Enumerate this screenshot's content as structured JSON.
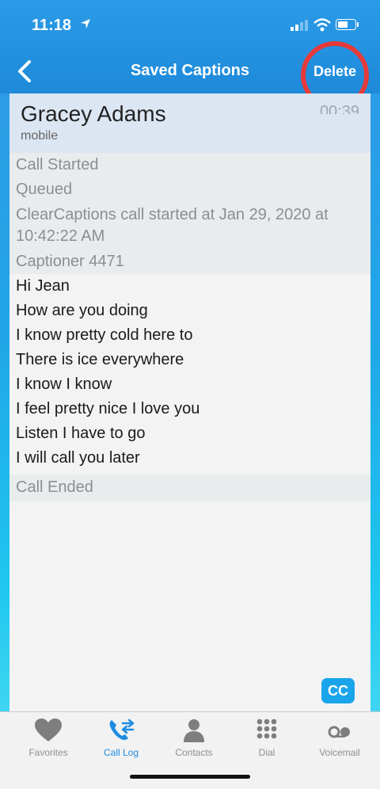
{
  "status": {
    "time": "11:18"
  },
  "nav": {
    "title": "Saved Captions",
    "delete_label": "Delete"
  },
  "contact": {
    "name": "Gracey Adams",
    "type": "mobile",
    "duration": "00:39"
  },
  "transcript": [
    {
      "text": "Call Started",
      "kind": "system"
    },
    {
      "text": "Queued",
      "kind": "system"
    },
    {
      "text": "ClearCaptions call started at Jan 29, 2020 at 10:42:22 AM",
      "kind": "system"
    },
    {
      "text": "Captioner 4471",
      "kind": "system"
    },
    {
      "text": "Hi Jean",
      "kind": "message"
    },
    {
      "text": "How are you doing",
      "kind": "message"
    },
    {
      "text": "I know pretty cold here to",
      "kind": "message"
    },
    {
      "text": "There is ice everywhere",
      "kind": "message"
    },
    {
      "text": "I know I know",
      "kind": "message"
    },
    {
      "text": "I feel pretty nice I love you",
      "kind": "message"
    },
    {
      "text": "Listen I have to go",
      "kind": "message"
    },
    {
      "text": "I will call you later",
      "kind": "message"
    },
    {
      "text": "Call Ended",
      "kind": "system"
    }
  ],
  "cc_label": "CC",
  "tabs": [
    {
      "label": "Favorites",
      "icon": "heart-icon"
    },
    {
      "label": "Call Log",
      "icon": "call-log-icon",
      "active": true
    },
    {
      "label": "Contacts",
      "icon": "person-icon"
    },
    {
      "label": "Dial",
      "icon": "keypad-icon"
    },
    {
      "label": "Voicemail",
      "icon": "voicemail-icon"
    }
  ],
  "colors": {
    "accent": "#1d8ce0",
    "nav_bar": "#2a9be8",
    "highlight_ring": "#e63a3a"
  }
}
